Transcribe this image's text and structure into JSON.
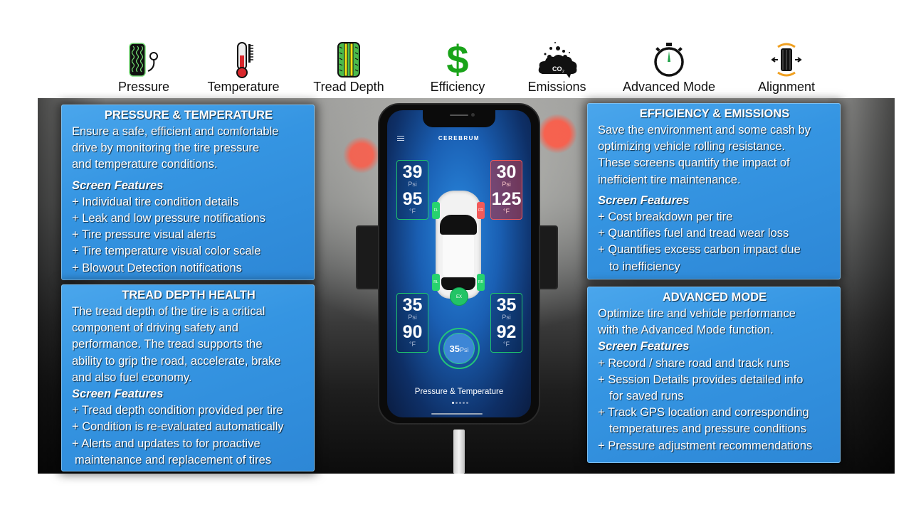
{
  "features": [
    {
      "icon": "tire-pressure-gauge-icon",
      "label": "Pressure"
    },
    {
      "icon": "thermometer-icon",
      "label": "Temperature"
    },
    {
      "icon": "tread-depth-icon",
      "label": "Tread Depth"
    },
    {
      "icon": "dollar-sign-icon",
      "label": "Efficiency"
    },
    {
      "icon": "co2-cloud-icon",
      "label": "Emissions"
    },
    {
      "icon": "stopwatch-icon",
      "label": "Advanced Mode"
    },
    {
      "icon": "alignment-tire-icon",
      "label": "Alignment"
    }
  ],
  "panels": {
    "pressure_temperature": {
      "title": "PRESSURE & TEMPERATURE",
      "desc": [
        "Ensure a safe, efficient and comfortable",
        "drive by monitoring the tire pressure",
        "and temperature conditions."
      ],
      "features_heading": "Screen Features",
      "items": [
        "+ Individual tire condition details",
        "+ Leak and low pressure notifications",
        "+ Tire pressure visual alerts",
        "+ Tire temperature visual color scale",
        "+ Blowout Detection notifications"
      ]
    },
    "tread_depth": {
      "title": "TREAD DEPTH HEALTH",
      "desc": [
        "The tread depth of the tire is a critical",
        "component of driving safety and",
        "performance.  The tread supports the",
        "ability to grip the road, accelerate, brake",
        "and also fuel economy."
      ],
      "features_heading": "Screen Features",
      "items": [
        "+ Tread depth condition provided per tire",
        "+ Condition is re-evaluated automatically",
        "+ Alerts and updates to for proactive"
      ],
      "items_cont": "maintenance and replacement of tires"
    },
    "efficiency_emissions": {
      "title": "EFFICIENCY & EMISSIONS",
      "desc": [
        "Save the environment and some cash by",
        "optimizing vehicle rolling resistance.",
        "These screens quantify the impact of",
        "inefficient tire maintenance."
      ],
      "features_heading": "Screen Features",
      "items": [
        "+ Cost breakdown per tire",
        "+ Quantifies fuel and tread wear loss",
        "+ Quantifies excess carbon impact due"
      ],
      "items_cont": "to inefficiency"
    },
    "advanced_mode": {
      "title": "ADVANCED MODE",
      "desc": [
        "Optimize tire and vehicle performance",
        "with the Advanced Mode function."
      ],
      "features_heading": "Screen Features",
      "items": [
        "+ Record / share road and track runs",
        "+ Session Details provides detailed info"
      ],
      "items_cont1": "for saved runs",
      "items2": "+ Track GPS location and corresponding",
      "items_cont2": "temperatures and pressure conditions",
      "items3": "+ Pressure adjustment recommendations"
    }
  },
  "phone": {
    "brand": "CEREBRUM",
    "tires": {
      "fl": {
        "pressure": "39",
        "pressure_unit": "Psi",
        "temp": "95",
        "temp_unit": "°F",
        "tag": "FL",
        "status": "ok"
      },
      "fr": {
        "pressure": "30",
        "pressure_unit": "Psi",
        "temp": "125",
        "temp_unit": "°F",
        "tag": "FR",
        "status": "alert"
      },
      "rl": {
        "pressure": "35",
        "pressure_unit": "Psi",
        "temp": "90",
        "temp_unit": "°F",
        "tag": "RL",
        "status": "ok"
      },
      "rr": {
        "pressure": "35",
        "pressure_unit": "Psi",
        "temp": "92",
        "temp_unit": "°F",
        "tag": "RR",
        "status": "ok"
      }
    },
    "spare": {
      "tag": "EX",
      "pressure": "35",
      "unit": "Psi"
    },
    "screen_title": "Pressure & Temperature",
    "page_index": 1,
    "page_count": 5
  },
  "colors": {
    "panel_blue": "#3595e2",
    "ok_green": "#1fc36b",
    "alert_red": "#f25757"
  }
}
